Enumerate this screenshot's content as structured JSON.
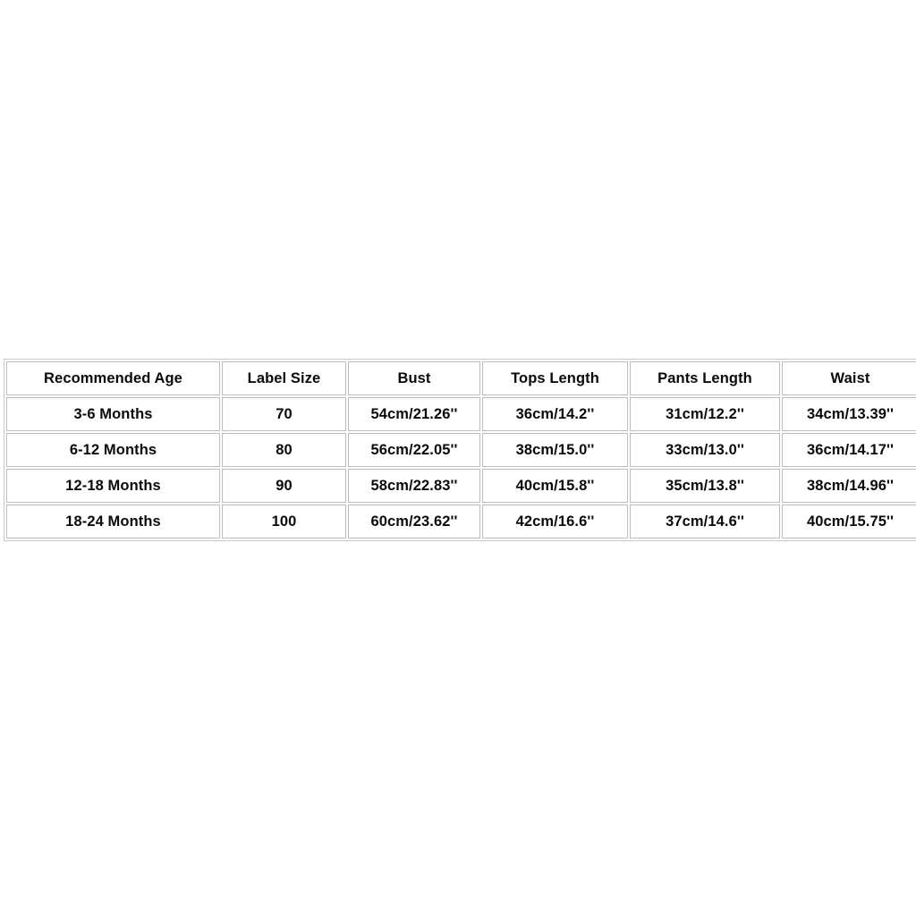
{
  "table": {
    "columns": [
      "Recommended Age",
      "Label Size",
      "Bust",
      "Tops Length",
      "Pants Length",
      "Waist"
    ],
    "rows": [
      [
        "3-6 Months",
        "70",
        "54cm/21.26''",
        "36cm/14.2''",
        "31cm/12.2''",
        "34cm/13.39''"
      ],
      [
        "6-12 Months",
        "80",
        "56cm/22.05''",
        "38cm/15.0''",
        "33cm/13.0''",
        "36cm/14.17''"
      ],
      [
        "12-18 Months",
        "90",
        "58cm/22.83''",
        "40cm/15.8''",
        "35cm/13.8''",
        "38cm/14.96''"
      ],
      [
        "18-24 Months",
        "100",
        "60cm/23.62''",
        "42cm/16.6''",
        "37cm/14.6''",
        "40cm/15.75''"
      ]
    ]
  },
  "colors": {
    "background": "#ffffff",
    "text": "#0a0a0a",
    "cell_border": "#bdbdbd",
    "table_border": "#c9c9c9"
  }
}
